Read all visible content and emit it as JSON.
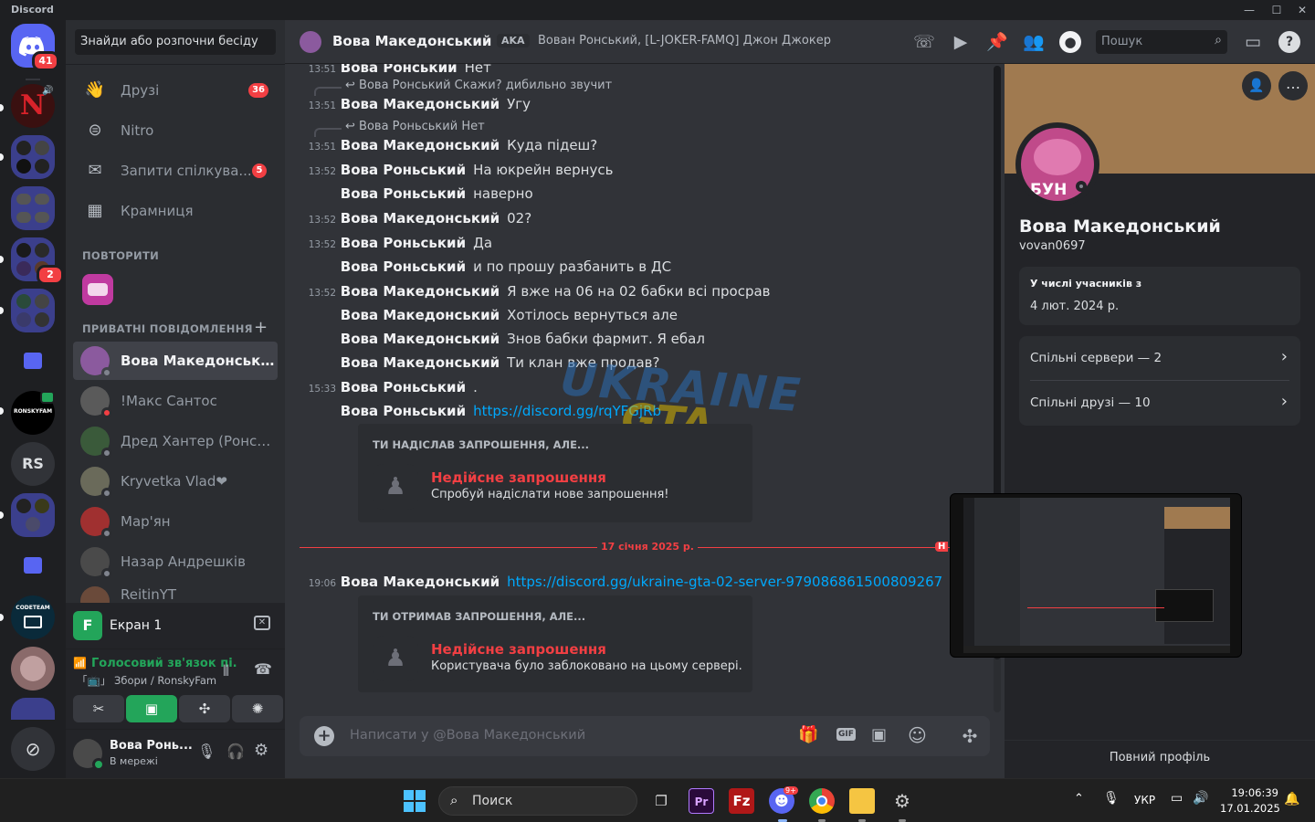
{
  "app": {
    "title": "Discord"
  },
  "servers": {
    "home_badge": "41",
    "badge_2": "2",
    "rs_label": "RS",
    "ronsky_label": "RONSKYFAM",
    "codeteam_label": "CODETEAM"
  },
  "dm_panel": {
    "search_placeholder": "Знайди або розпочни бесіду",
    "nav": [
      {
        "label": "Друзі",
        "badge": "36"
      },
      {
        "label": "Nitro",
        "badge": ""
      },
      {
        "label": "Запити спілкува...",
        "badge": "5"
      },
      {
        "label": "Крамниця",
        "badge": ""
      }
    ],
    "section_repeat": "ПОВТОРИТИ",
    "section_dm": "ПРИВАТНІ ПОВІДОМЛЕННЯ",
    "dms": [
      {
        "name": "Вова Македонський",
        "status": "#80848e",
        "color": "#8b5a9e"
      },
      {
        "name": "!Макс Сантос",
        "status": "#f23f43",
        "color": "#5a5a5a"
      },
      {
        "name": "Дред Хантер (Ронськ...",
        "status": "#80848e",
        "color": "#3a5a3a"
      },
      {
        "name": "Kryvetka Vlad❤",
        "status": "#80848e",
        "color": "#6a6a5a"
      },
      {
        "name": "Мар'ян",
        "status": "#80848e",
        "color": "#a03030"
      },
      {
        "name": "Назар Андрешків",
        "status": "#80848e",
        "color": "#4a4a4a"
      },
      {
        "name": "ReitinYT",
        "status": "#80848e",
        "color": "#6a4a3a"
      }
    ],
    "screen": {
      "label": "Екран 1",
      "letter": "F"
    },
    "voice": {
      "status": "Голосовий зв'язок пі.",
      "channel": "「📺」 Збори / RonskyFam"
    },
    "user": {
      "name": "Вова Ронь...",
      "status": "В мережі"
    }
  },
  "chat": {
    "header": {
      "name": "Вова Македонський",
      "aka_label": "AKA",
      "aka": "Вован Ронський, [L-JOKER-FAMQ] Джон Джокер",
      "search_placeholder": "Пошук"
    },
    "messages": [
      {
        "time": "13:51",
        "author": "Вова Ронський",
        "text": "Нет"
      },
      {
        "reply_author": "Вова Ронський",
        "reply_text": "Скажи? дибильно звучит"
      },
      {
        "time": "13:51",
        "author": "Вова Македонський",
        "text": "Угу"
      },
      {
        "reply_author": "Вова Роньський",
        "reply_text": "Нет"
      },
      {
        "time": "13:51",
        "author": "Вова Македонський",
        "text": "Куда підеш?"
      },
      {
        "time": "13:52",
        "author": "Вова Роньський",
        "text": "На юкрейн вернусь"
      },
      {
        "time": "",
        "author": "Вова Роньський",
        "text": "наверно"
      },
      {
        "time": "13:52",
        "author": "Вова Македонський",
        "text": "02?"
      },
      {
        "time": "13:52",
        "author": "Вова Роньський",
        "text": "Да"
      },
      {
        "time": "",
        "author": "Вова Роньський",
        "text": "и по прошу разбанить в ДС"
      },
      {
        "time": "13:52",
        "author": "Вова Македонський",
        "text": "Я вже на 06 на 02 бабки всі просрав"
      },
      {
        "time": "",
        "author": "Вова Македонський",
        "text": "Хотілось вернуться але"
      },
      {
        "time": "",
        "author": "Вова Македонський",
        "text": "Знов бабки фармит. Я ебал"
      },
      {
        "time": "",
        "author": "Вова Македонський",
        "text": "Ти клан вже продав?"
      },
      {
        "time": "15:33",
        "author": "Вова Роньський",
        "text": "."
      },
      {
        "time": "",
        "author": "Вова Роньський",
        "link": "https://discord.gg/rqYFGjRb"
      },
      {
        "time": "19:06",
        "author": "Вова Македонський",
        "link": "https://discord.gg/ukraine-gta-02-server-979086861500809267"
      }
    ],
    "invite1": {
      "heading": "ТИ НАДІСЛАВ ЗАПРОШЕННЯ, АЛЕ...",
      "title": "Недійсне запрошення",
      "subtitle": "Спробуй надіслати нове запрошення!"
    },
    "invite2": {
      "heading": "ТИ ОТРИМАВ ЗАПРОШЕННЯ, АЛЕ...",
      "title": "Недійсне запрошення",
      "subtitle": "Користувача було заблоковано на цьому сервері."
    },
    "date_divider": "17 січня 2025 р.",
    "new_label": "Н",
    "composer_placeholder": "Написати у @Вова Македонський",
    "watermark_line1": "UKRAINE",
    "watermark_line2": "GTA"
  },
  "profile": {
    "name": "Вова Македонський",
    "username": "vovan0697",
    "avatar_text": "БУН",
    "member_since_label": "У числі учасників з",
    "member_since": "4 лют. 2024 р.",
    "mutual_servers": "Спільні сервери — 2",
    "mutual_friends": "Спільні друзі — 10",
    "full_profile": "Повний профіль",
    "banner_color": "#a07a50"
  },
  "taskbar": {
    "search_placeholder": "Поиск",
    "discord_badge": "9+",
    "lang": "УКР",
    "time": "19:06:39",
    "date": "17.01.2025"
  },
  "colors": {
    "accent": "#5865f2",
    "danger": "#f23f43",
    "link": "#00a8fc",
    "online": "#23a55a"
  }
}
